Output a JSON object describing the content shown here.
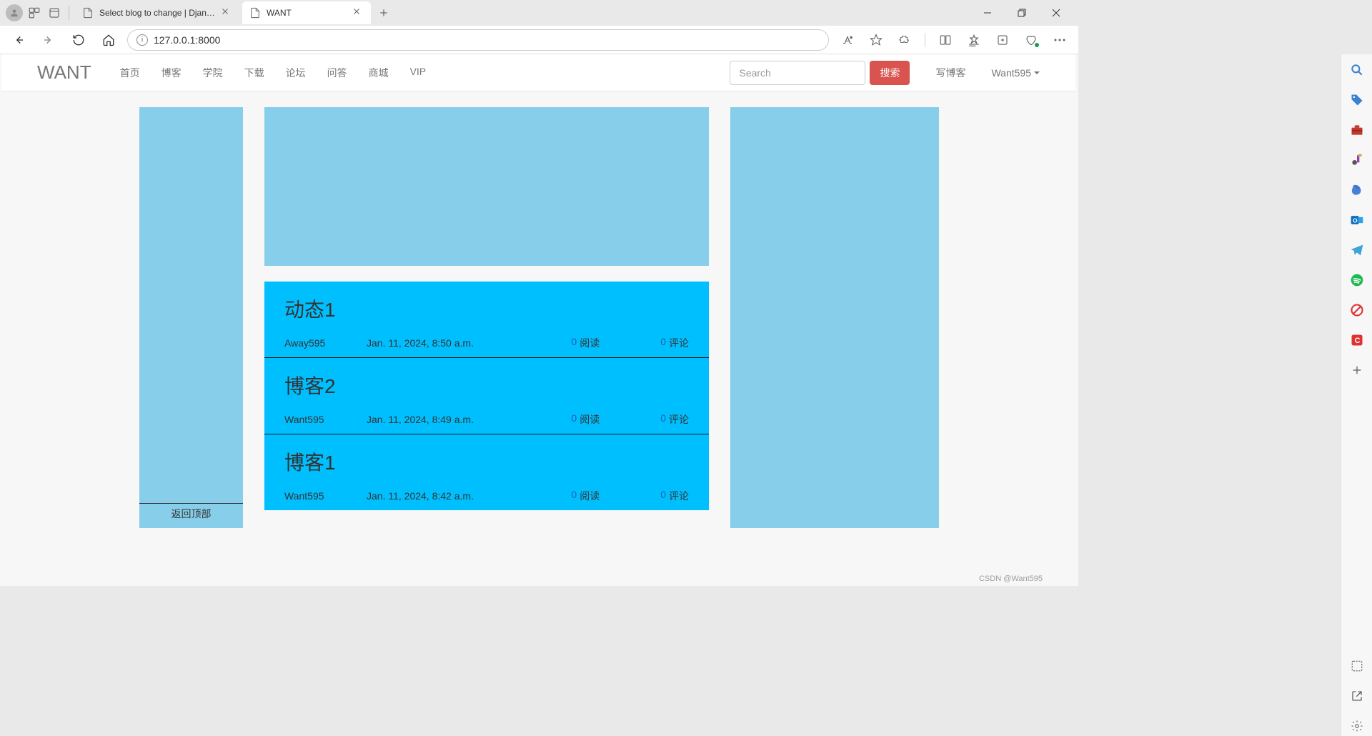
{
  "browser": {
    "tabs": [
      {
        "title": "Select blog to change | Django si",
        "active": false
      },
      {
        "title": "WANT",
        "active": true
      }
    ],
    "url": "127.0.0.1:8000"
  },
  "navbar": {
    "brand": "WANT",
    "links": [
      "首页",
      "博客",
      "学院",
      "下载",
      "论坛",
      "问答",
      "商城",
      "VIP"
    ],
    "search_placeholder": "Search",
    "search_button": "搜索",
    "write_blog": "写博客",
    "username": "Want595"
  },
  "left_sidebar": {
    "back_to_top": "返回顶部"
  },
  "posts": [
    {
      "title": "动态1",
      "author": "Away595",
      "date": "Jan. 11, 2024, 8:50 a.m.",
      "read_count": "0",
      "read_label": "阅读",
      "comment_count": "0",
      "comment_label": "评论"
    },
    {
      "title": "博客2",
      "author": "Want595",
      "date": "Jan. 11, 2024, 8:49 a.m.",
      "read_count": "0",
      "read_label": "阅读",
      "comment_count": "0",
      "comment_label": "评论"
    },
    {
      "title": "博客1",
      "author": "Want595",
      "date": "Jan. 11, 2024, 8:42 a.m.",
      "read_count": "0",
      "read_label": "阅读",
      "comment_count": "0",
      "comment_label": "评论"
    }
  ],
  "watermark": "CSDN @Want595"
}
